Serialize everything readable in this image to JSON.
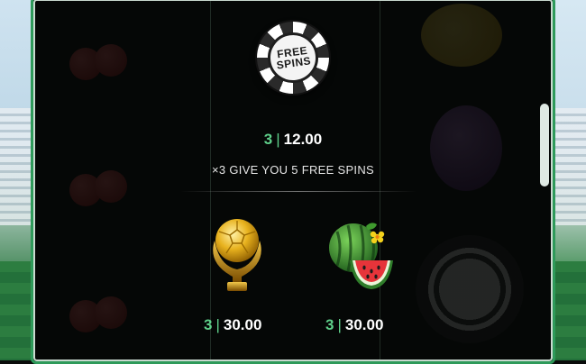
{
  "free_spins_symbol": {
    "label_line1": "FREE",
    "label_line2": "SPINS"
  },
  "free_spins_paytable": {
    "count": "3",
    "separator": "|",
    "payout": "12.00",
    "description": "×3 GIVE YOU 5 FREE SPINS"
  },
  "symbols": [
    {
      "name": "golden-trophy",
      "count": "3",
      "separator": "|",
      "payout": "30.00"
    },
    {
      "name": "watermelon",
      "count": "3",
      "separator": "|",
      "payout": "30.00"
    }
  ],
  "background_chip": {
    "label_line1": "FREE",
    "label_line2": "SPINS"
  },
  "colors": {
    "accent": "#5fd08a",
    "frame": "#2e9a5a",
    "background": "#0a0c0b"
  }
}
